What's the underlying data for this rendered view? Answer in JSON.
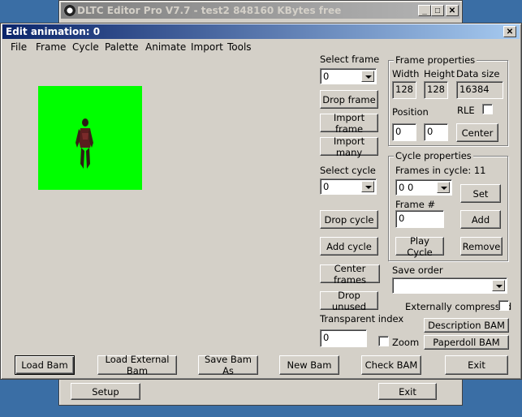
{
  "bg_window": {
    "title": "DLTC Editor Pro V7.7 - test2  848160 KBytes free",
    "buttons": {
      "minimize": "_",
      "maximize": "□",
      "close": "✕"
    },
    "setup_label": "Setup",
    "exit_label": "Exit"
  },
  "dialog": {
    "title": "Edit animation: 0",
    "close": "✕"
  },
  "menu": [
    "File",
    "Frame",
    "Cycle",
    "Palette",
    "Animate",
    "Import",
    "Tools"
  ],
  "select_frame": {
    "label": "Select frame",
    "value": "0"
  },
  "frame_buttons": {
    "drop": "Drop frame",
    "import": "Import frame",
    "import_many": "Import many"
  },
  "select_cycle": {
    "label": "Select cycle",
    "value": "0"
  },
  "cycle_buttons": {
    "drop": "Drop cycle",
    "add": "Add cycle",
    "center": "Center frames",
    "drop_unused": "Drop unused"
  },
  "frame_props": {
    "title": "Frame properties",
    "width_label": "Width",
    "height_label": "Height",
    "datasize_label": "Data size",
    "width": "128",
    "height": "128",
    "datasize": "16384",
    "position_label": "Position",
    "rle_label": "RLE",
    "pos_x": "0",
    "pos_y": "0",
    "center_label": "Center"
  },
  "cycle_props": {
    "title": "Cycle properties",
    "frames_in_cycle": "Frames in cycle: 11",
    "combo_value": "0 0",
    "set_label": "Set",
    "frame_num_label": "Frame #",
    "frame_num_value": "0",
    "add_label": "Add",
    "play_label": "Play Cycle",
    "remove_label": "Remove"
  },
  "save_order": {
    "label": "Save order",
    "value": ""
  },
  "ext_compressed": "Externally compressed",
  "transparent": {
    "label": "Transparent index",
    "value": "0"
  },
  "zoom_label": "Zoom",
  "desc_bam": "Description BAM",
  "paperdoll_bam": "Paperdoll BAM",
  "bottom_buttons": {
    "load": "Load Bam",
    "load_ext": "Load External Bam",
    "save_as": "Save Bam As",
    "new": "New Bam",
    "check": "Check BAM",
    "exit": "Exit"
  },
  "colors": {
    "preview_bg": "#00ff00",
    "title_active": "#0a246a",
    "face": "#d4d0c8"
  }
}
